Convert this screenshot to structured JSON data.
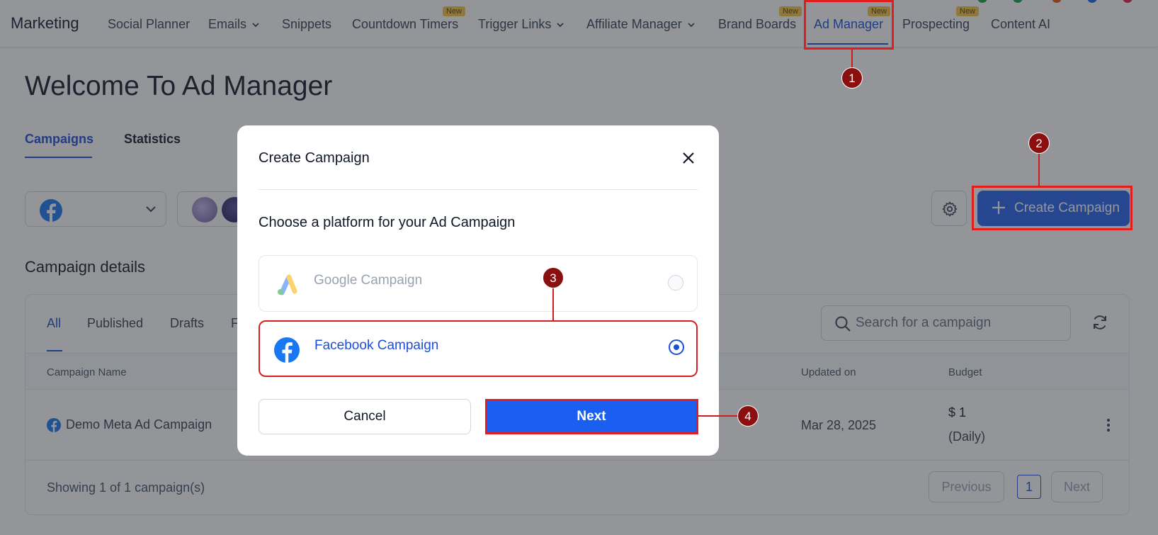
{
  "nav": {
    "brand": "Marketing",
    "items": [
      {
        "label": "Social Planner"
      },
      {
        "label": "Emails"
      },
      {
        "label": "Snippets"
      },
      {
        "label": "Countdown Timers",
        "badge": "New"
      },
      {
        "label": "Trigger Links"
      },
      {
        "label": "Affiliate Manager"
      },
      {
        "label": "Brand Boards",
        "badge": "New"
      },
      {
        "label": "Ad Manager",
        "badge": "New",
        "active": true
      },
      {
        "label": "Prospecting",
        "badge": "New"
      },
      {
        "label": "Content AI"
      }
    ]
  },
  "page": {
    "title": "Welcome To Ad Manager",
    "tabs": [
      {
        "label": "Campaigns",
        "active": true
      },
      {
        "label": "Statistics"
      }
    ],
    "create_button": "Create Campaign",
    "section_title": "Campaign details"
  },
  "campaigns": {
    "filters": [
      {
        "label": "All",
        "active": true
      },
      {
        "label": "Published"
      },
      {
        "label": "Drafts"
      },
      {
        "label": "F"
      }
    ],
    "search_placeholder": "Search for a campaign",
    "columns": [
      "Campaign Name",
      "Updated on",
      "Budget"
    ],
    "rows": [
      {
        "name": "Demo Meta Ad Campaign",
        "updated_on": "Mar 28, 2025",
        "budget": "$ 1",
        "budget_period": "(Daily)"
      }
    ],
    "footer": "Showing 1 of 1 campaign(s)",
    "pagination": {
      "previous": "Previous",
      "page": "1",
      "next": "Next"
    }
  },
  "modal": {
    "title": "Create Campaign",
    "subtitle": "Choose a platform for your Ad Campaign",
    "options": [
      {
        "label": "Google Campaign",
        "selected": false
      },
      {
        "label": "Facebook Campaign",
        "selected": true
      }
    ],
    "cancel": "Cancel",
    "next": "Next"
  },
  "annotations": [
    "1",
    "2",
    "3",
    "4"
  ],
  "colors": {
    "accent": "#2563eb",
    "annotation": "#8b0f0f",
    "highlight": "#e11d1d",
    "badge": "#f5c542"
  }
}
